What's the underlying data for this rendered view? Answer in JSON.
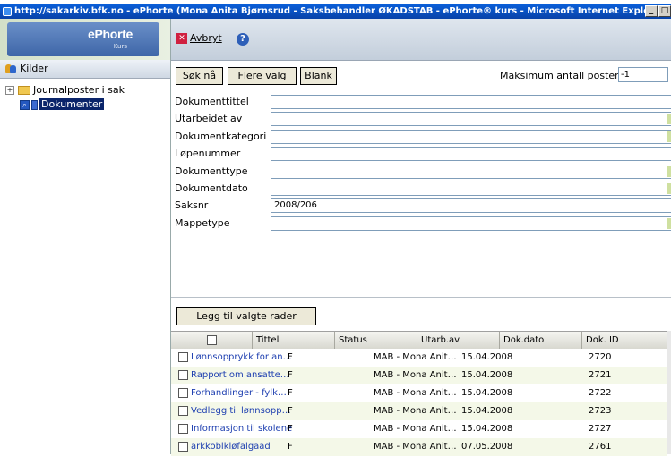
{
  "window": {
    "title": "http://sakarkiv.bfk.no - ePhorte (Mona Anita Bjørnsrud - Saksbehandler ØKADSTAB - ePhorte® kurs - Microsoft Internet Explorer",
    "min": "_",
    "max": "□"
  },
  "logo": {
    "brand": "ePhorte",
    "sub": "Kurs"
  },
  "sidebar": {
    "header": "Kilder",
    "tree": [
      {
        "label": "Journalposter i sak",
        "expander": "+"
      },
      {
        "label": "Dokumenter",
        "selected": true
      }
    ]
  },
  "toolbar": {
    "cancel_label": "Avbryt",
    "help": "?"
  },
  "search": {
    "search_now": "Søk nå",
    "more_options": "Flere valg",
    "blank": "Blank",
    "max_label": "Maksimum antall poster",
    "max_value": "-1"
  },
  "fields": [
    {
      "label": "Dokumenttittel",
      "value": "",
      "dropdown": false
    },
    {
      "label": "Utarbeidet av",
      "value": "",
      "dropdown": true
    },
    {
      "label": "Dokumentkategori",
      "value": "",
      "dropdown": true
    },
    {
      "label": "Løpenummer",
      "value": "",
      "dropdown": false
    },
    {
      "label": "Dokumenttype",
      "value": "",
      "dropdown": true
    },
    {
      "label": "Dokumentdato",
      "value": "",
      "dropdown": true
    },
    {
      "label": "Saksnr",
      "value": "2008/206",
      "dropdown": false
    },
    {
      "label": "Mappetype",
      "value": "",
      "dropdown": true
    }
  ],
  "results": {
    "add_selected": "Legg til valgte rader",
    "columns": [
      "Tittel",
      "Status",
      "Utarb.av",
      "Dok.dato",
      "Dok. ID"
    ],
    "rows": [
      {
        "title": "Lønnsopprykk for an…",
        "status": "F",
        "author": "MAB - Mona Anit…",
        "date": "15.04.2008",
        "id": "2720"
      },
      {
        "title": "Rapport om ansatte…",
        "status": "F",
        "author": "MAB - Mona Anit…",
        "date": "15.04.2008",
        "id": "2721"
      },
      {
        "title": "Forhandlinger - fylk…",
        "status": "F",
        "author": "MAB - Mona Anit…",
        "date": "15.04.2008",
        "id": "2722"
      },
      {
        "title": "Vedlegg til lønnsopp…",
        "status": "F",
        "author": "MAB - Mona Anit…",
        "date": "15.04.2008",
        "id": "2723"
      },
      {
        "title": "Informasjon til skolene",
        "status": "F",
        "author": "MAB - Mona Anit…",
        "date": "15.04.2008",
        "id": "2727"
      },
      {
        "title": "arkkoblkløfalgaad",
        "status": "F",
        "author": "MAB - Mona Anit…",
        "date": "07.05.2008",
        "id": "2761"
      }
    ]
  },
  "colors": {
    "titlebar": "#0842a8",
    "link": "#1e3fb0",
    "selection": "#0a246a"
  }
}
